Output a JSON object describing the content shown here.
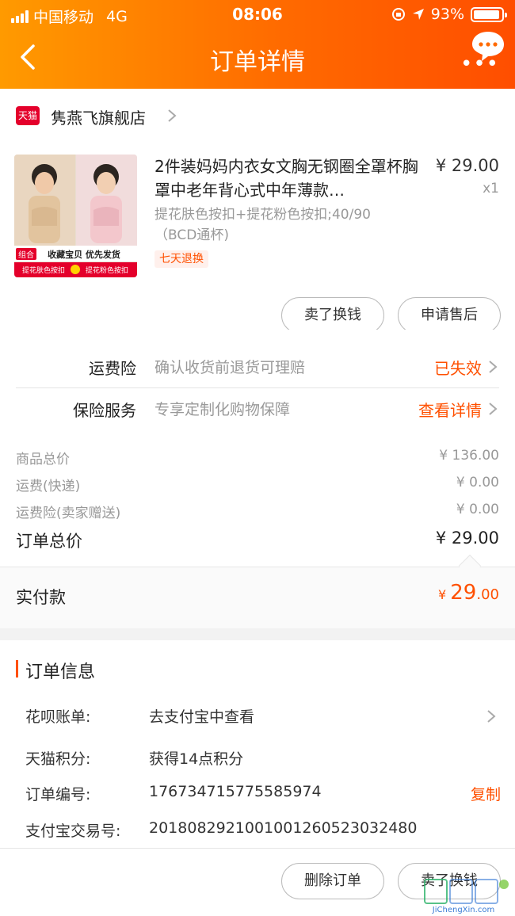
{
  "status_bar": {
    "carrier": "中国移动",
    "network": "4G",
    "time": "08:06",
    "battery": "93%",
    "battery_level": 0.93
  },
  "nav": {
    "title": "订单详情"
  },
  "store": {
    "badge": "天猫",
    "name": "隽燕飞旗舰店"
  },
  "product": {
    "title": "2件装妈妈内衣女文胸无钢圈全罩杯胸罩中老年背心式中年薄款…",
    "price": "¥ 29.00",
    "quantity": "x1",
    "sku": "提花肤色按扣+提花粉色按扣;40/90（BCD通杯)",
    "tag": "七天退换",
    "image_text": {
      "combo": "组合",
      "banner": "收藏宝贝 优先发货",
      "left_label": "提花肤色按扣",
      "right_label": "提花粉色按扣"
    }
  },
  "actions": {
    "sell": "卖了换钱",
    "after_sale": "申请售后"
  },
  "insurance": [
    {
      "label": "运费险",
      "desc": "确认收货前退货可理赔",
      "status": "已失效"
    },
    {
      "label": "保险服务",
      "desc": "专享定制化购物保障",
      "status": "查看详情"
    }
  ],
  "prices": {
    "goods_total_label": "商品总价",
    "goods_total": "¥ 136.00",
    "shipping_label": "运费(快递)",
    "shipping": "¥ 0.00",
    "shipping_ins_label": "运费险(卖家赠送)",
    "shipping_ins": "¥ 0.00",
    "order_total_label": "订单总价",
    "order_total": "¥ 29.00"
  },
  "paid": {
    "label": "实付款",
    "currency": "¥",
    "integer": "29",
    "decimal": ".00"
  },
  "order_info": {
    "title": "订单信息",
    "rows": [
      {
        "key": "花呗账单:",
        "value": "去支付宝中查看"
      },
      {
        "key": "天猫积分:",
        "value": "获得14点积分"
      },
      {
        "key": "订单编号:",
        "value": "176734715775585974",
        "action": "复制"
      },
      {
        "key": "支付宝交易号:",
        "value": "2018082921001001260523032480"
      }
    ]
  },
  "footer": {
    "delete": "删除订单",
    "sell": "卖了换钱"
  },
  "watermark": {
    "text": "JiChengXin.com"
  },
  "colors": {
    "accent": "#ff5000",
    "header_start": "#ff9a00",
    "header_end": "#ff4e00",
    "tmall_red": "#e4002b"
  }
}
